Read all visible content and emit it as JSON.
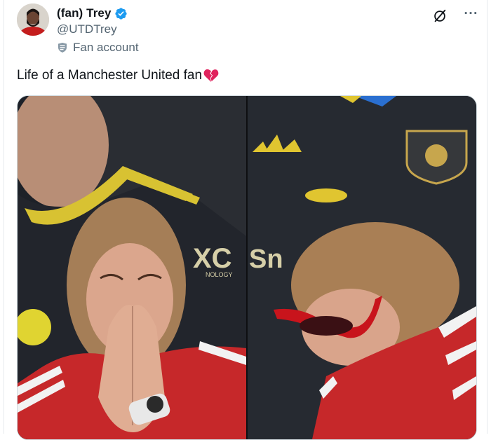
{
  "author": {
    "display_name": "(fan) Trey",
    "handle": "@UTDTrey",
    "verified": true,
    "label": "Fan account"
  },
  "tweet": {
    "text": "Life of a Manchester United fan"
  },
  "media": {
    "description_icons": [
      "broken-heart-emoji"
    ],
    "text_in_image": [
      "XC",
      "Sn",
      "NOLOGY"
    ]
  },
  "colors": {
    "verified": "#1d9bf0",
    "muted": "#536471",
    "heart": "#e0245e"
  }
}
